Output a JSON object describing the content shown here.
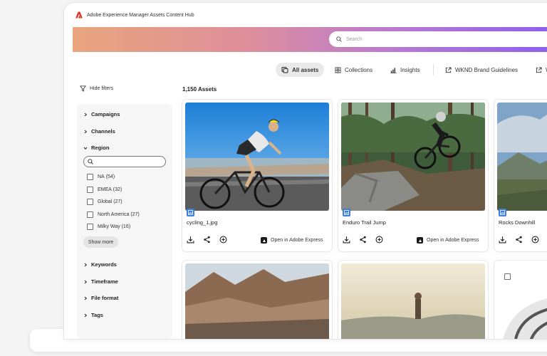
{
  "app": {
    "title": "Adobe Experience Manager Assets Content Hub"
  },
  "search": {
    "placeholder": "Search"
  },
  "nav": {
    "all_assets": "All assets",
    "collections": "Collections",
    "insights": "Insights",
    "brand_guidelines": "WKND Brand Guidelines",
    "next_cut": "W"
  },
  "filters": {
    "hide_label": "Hide filters",
    "campaigns": "Campaigns",
    "channels": "Channels",
    "region": "Region",
    "region_options": [
      {
        "name": "NA",
        "count": "(54)"
      },
      {
        "name": "EMEA",
        "count": "(32)"
      },
      {
        "name": "Global",
        "count": "(27)"
      },
      {
        "name": "North America",
        "count": "(27)"
      },
      {
        "name": "Milky Way",
        "count": "(16)"
      }
    ],
    "show_more": "Show more",
    "keywords": "Keywords",
    "timeframe": "Timeframe",
    "file_format": "File format",
    "tags": "Tags"
  },
  "assets": {
    "count_label": "1,150 Assets",
    "open_express": "Open in Adobe Express",
    "cards": [
      {
        "title": "cycling_1.jpg"
      },
      {
        "title": "Enduro Trail Jump"
      },
      {
        "title": "Rocks Downhill"
      }
    ]
  }
}
